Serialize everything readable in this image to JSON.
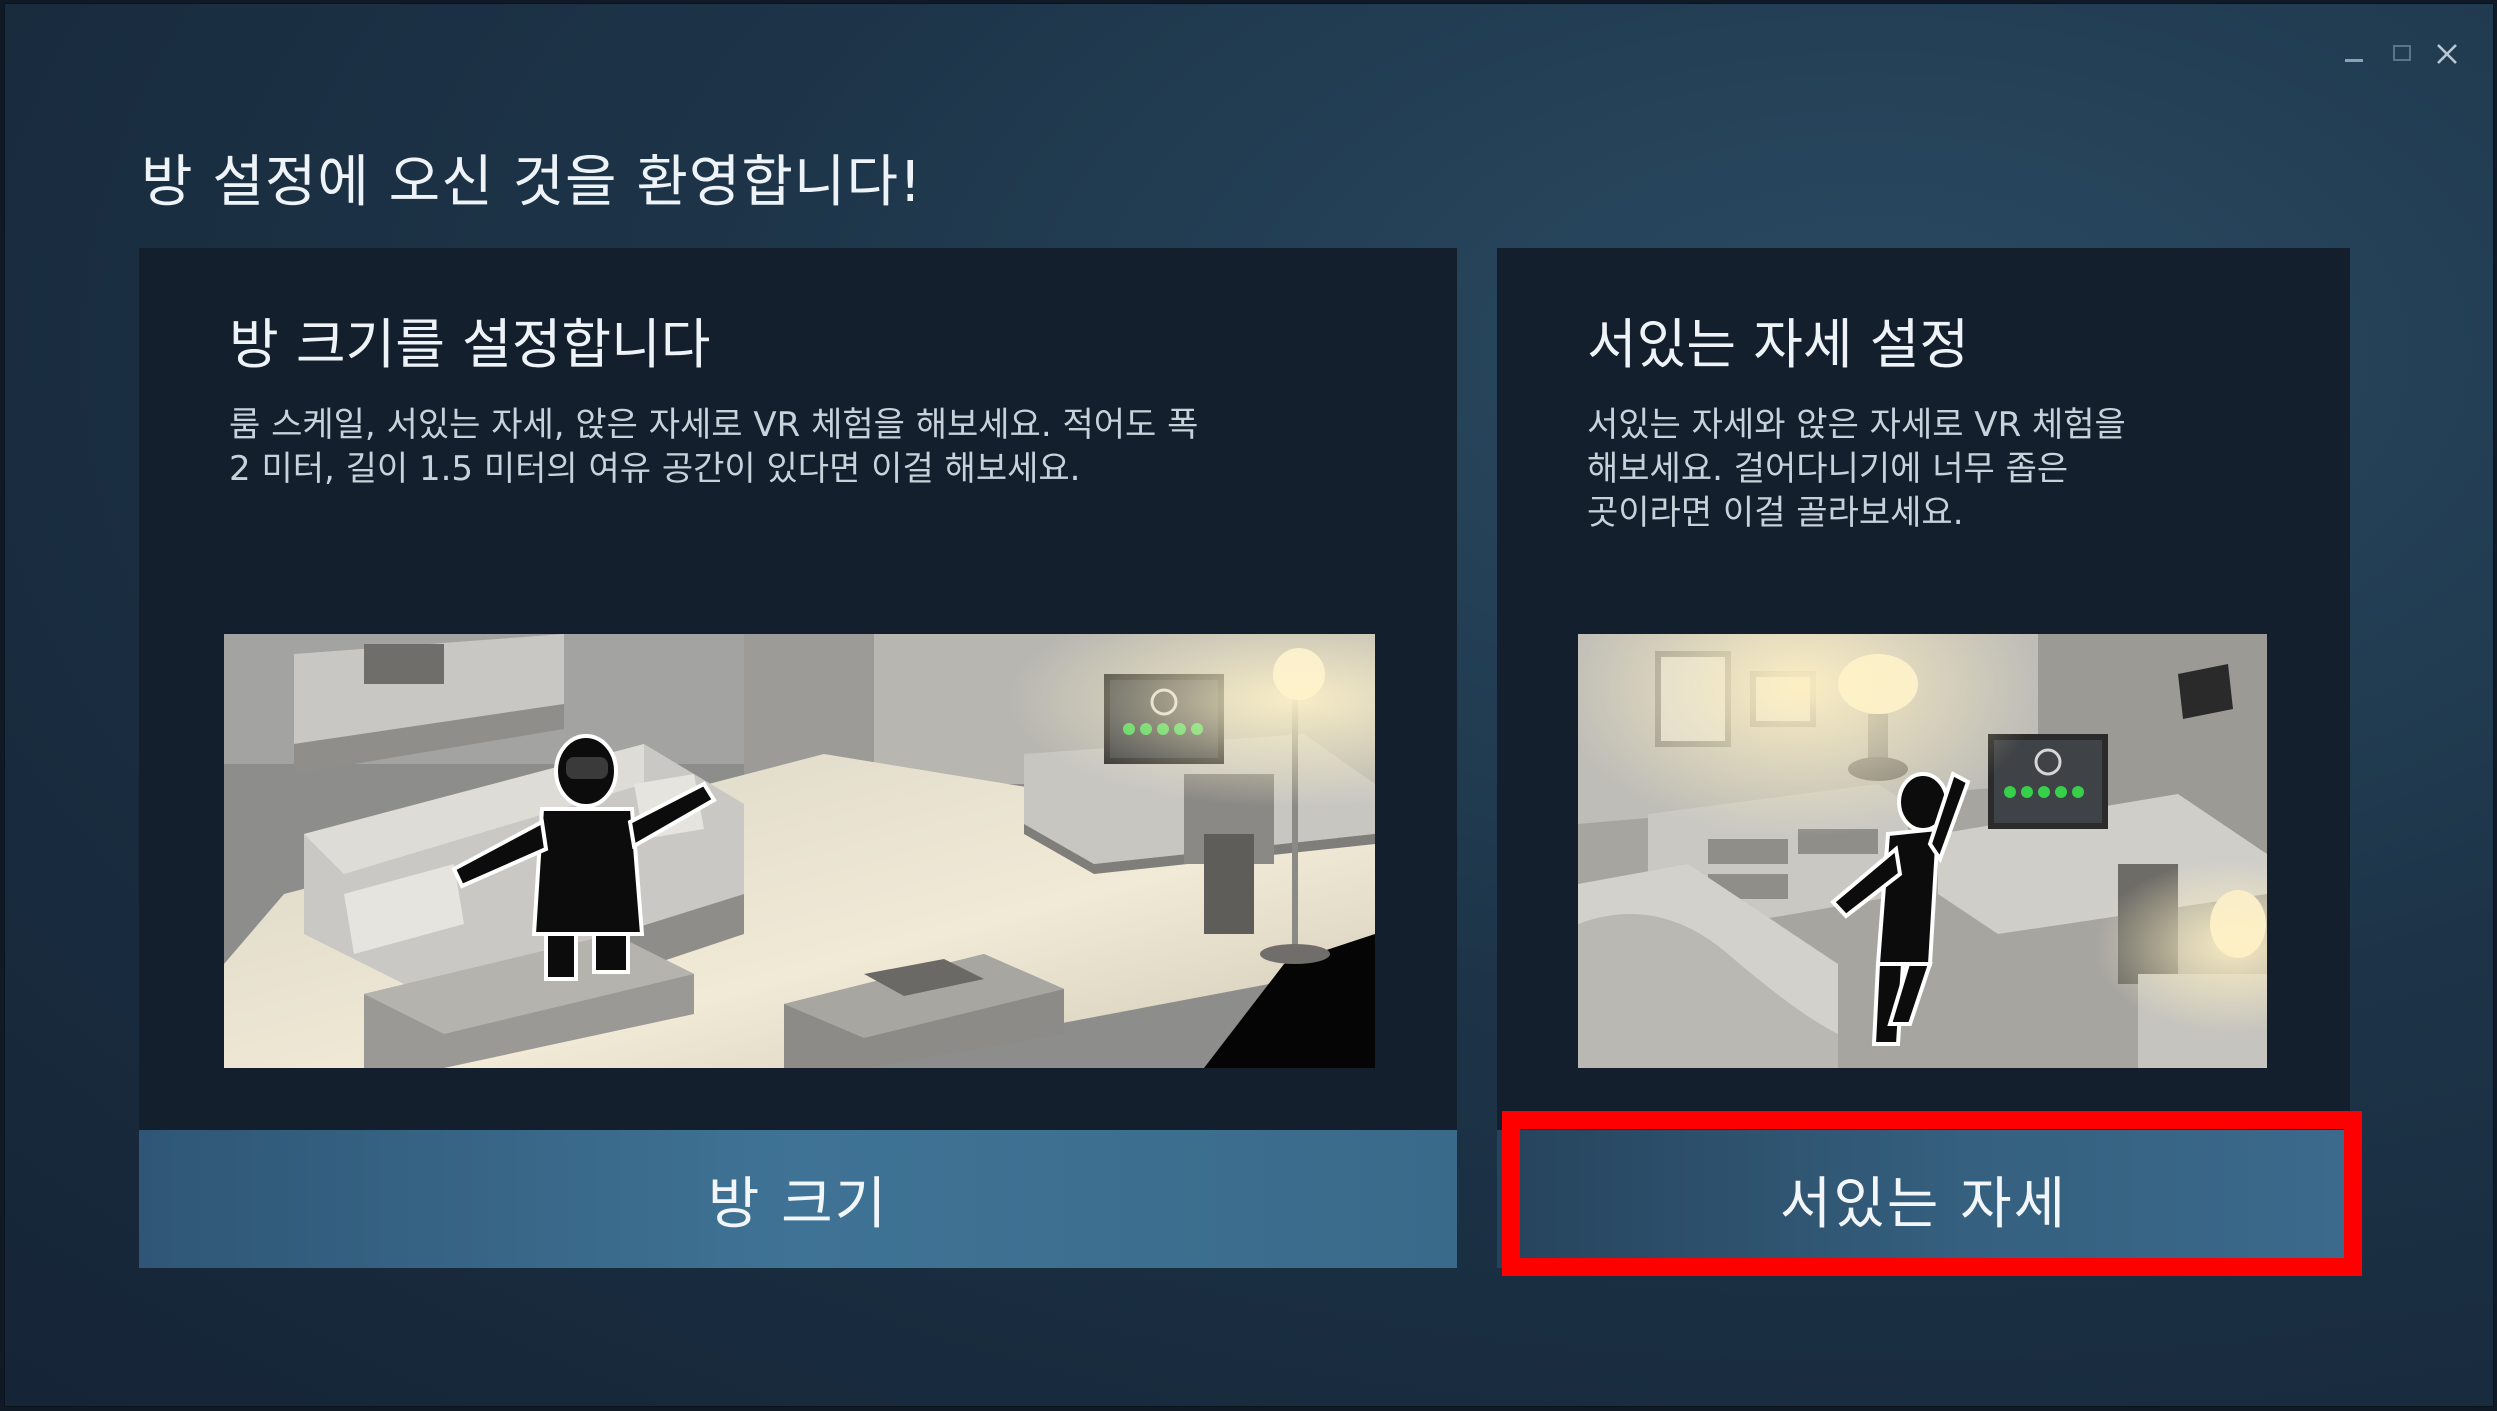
{
  "window": {
    "controls": [
      "minimize-icon",
      "maximize-icon",
      "close-icon"
    ]
  },
  "header": {
    "title": "방 설정에 오신 것을 환영합니다!"
  },
  "room_scale": {
    "heading": "방 크기를 설정합니다",
    "description": "룸 스케일, 서있는 자세, 앉은 자세로 VR 체험을 해보세요. 적어도 폭\n2 미터, 길이 1.5 미터의 여유 공간이 있다면 이걸 해보세요.",
    "button_label": "방 크기"
  },
  "standing": {
    "heading": "서있는 자세 설정",
    "description": "서있는 자세와 앉은 자세로 VR 체험을\n해보세요. 걸어다니기에 너무 좁은\n곳이라면 이걸 골라보세요.",
    "button_label": "서있는 자세"
  },
  "colors": {
    "accent_highlight": "#ff0000",
    "button_blue": "#3f7395",
    "panel_bg": "#141f2d"
  }
}
